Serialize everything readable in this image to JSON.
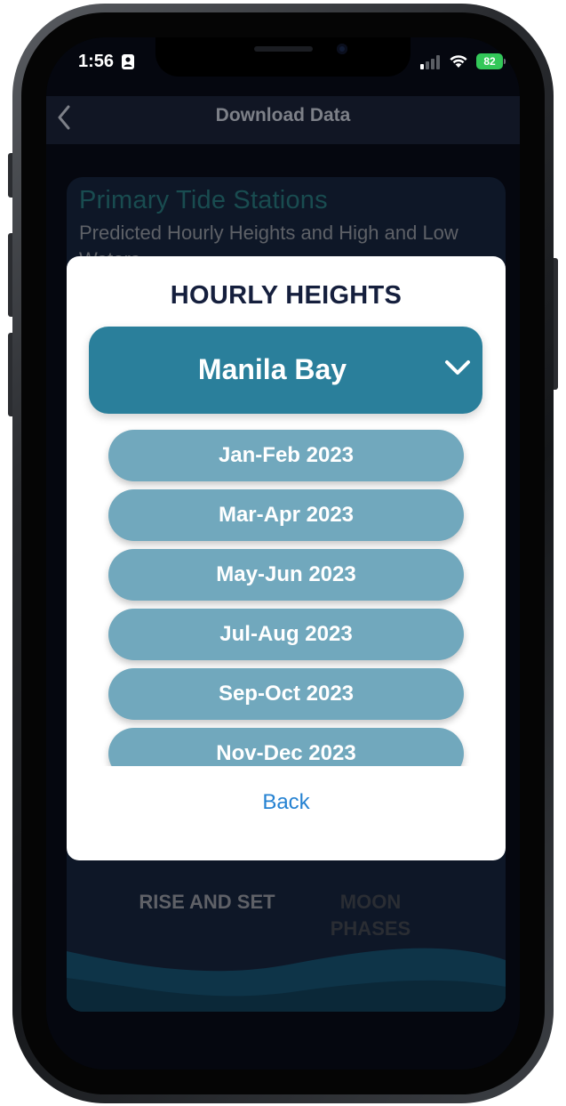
{
  "status_bar": {
    "time": "1:56",
    "battery": "82"
  },
  "nav": {
    "title": "Download Data"
  },
  "background": {
    "card_title": "Primary Tide Stations",
    "card_subtitle": "Predicted Hourly Heights and High and Low Waters",
    "rise_and_set": "RISE AND SET",
    "moon_phases": "MOON PHASES"
  },
  "modal": {
    "title": "HOURLY HEIGHTS",
    "station": "Manila Bay",
    "ranges": [
      "Jan-Feb 2023",
      "Mar-Apr 2023",
      "May-Jun 2023",
      "Jul-Aug 2023",
      "Sep-Oct 2023",
      "Nov-Dec 2023"
    ],
    "back_label": "Back"
  },
  "colors": {
    "accent": "#2a7f9b",
    "range_button": "#71a8bd",
    "link": "#2582d2",
    "battery": "#33c759"
  }
}
